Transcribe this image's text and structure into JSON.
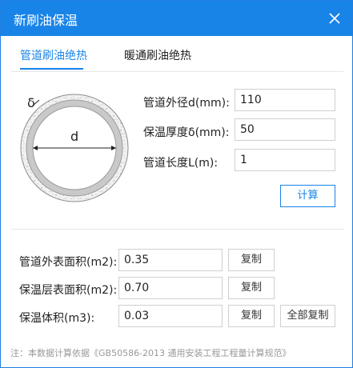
{
  "window": {
    "title": "新刷油保温"
  },
  "tabs": [
    {
      "label": "管道刷油绝热",
      "active": true
    },
    {
      "label": "暖通刷油绝热",
      "active": false
    }
  ],
  "diagram": {
    "delta_label": "δ",
    "d_label": "d"
  },
  "inputs": {
    "outer_diameter": {
      "label": "管道外径d(mm):",
      "value": "110"
    },
    "insulation_thickness": {
      "label": "保温厚度δ(mm):",
      "value": "50"
    },
    "pipe_length": {
      "label": "管道长度L(m):",
      "value": "1"
    }
  },
  "calculate_label": "计算",
  "results": {
    "outer_surface_area": {
      "label": "管道外表面积(m2):",
      "value": "0.35",
      "copy_label": "复制"
    },
    "insulation_surface_area": {
      "label": "保温层表面积(m2):",
      "value": "0.70",
      "copy_label": "复制"
    },
    "insulation_volume": {
      "label": "保温体积(m3):",
      "value": "0.03",
      "copy_label": "复制"
    }
  },
  "copy_all_label": "全部复制",
  "note": "注：本数据计算依据《GB50586-2013 通用安装工程工程量计算规范》",
  "colors": {
    "accent": "#1984e8",
    "title_text": "#ffffff",
    "note_text": "#999999"
  }
}
